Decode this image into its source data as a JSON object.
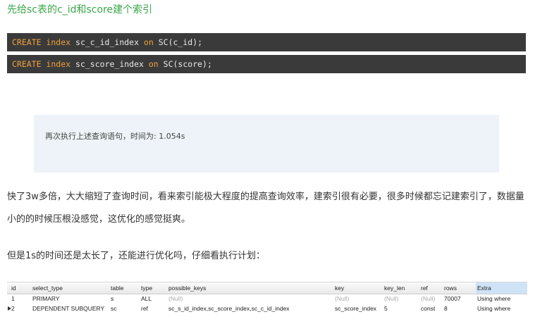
{
  "heading": "先给sc表的c_id和score建个索引",
  "code_lines": [
    {
      "kw1": "CREATE index",
      "name": " sc_c_id_index ",
      "kw2": "on",
      "rest": " SC(c_id);"
    },
    {
      "kw1": "CREATE index",
      "name": " sc_score_index ",
      "kw2": "on",
      "rest": " SC(score);"
    }
  ],
  "quote_text": "再次执行上述查询语句，时间为: 1.054s",
  "para1": "快了3w多倍，大大缩短了查询时间，看来索引能极大程度的提高查询效率，建索引很有必要，很多时候都忘记建索引了，数据量小的的时候压根没感觉，这优化的感觉挺爽。",
  "para2": "但是1s的时间还是太长了，还能进行优化吗，仔细看执行计划：",
  "result_table": {
    "columns": [
      "id",
      "select_type",
      "table",
      "type",
      "possible_keys",
      "key",
      "key_len",
      "ref",
      "rows",
      "Extra"
    ],
    "rows": [
      [
        "1",
        "PRIMARY",
        "s",
        "ALL",
        "(Null)",
        "(Null)",
        "(Null)",
        "(Null)",
        "70007",
        "Using where"
      ],
      [
        "2",
        "DEPENDENT SUBQUERY",
        "sc",
        "ref",
        "sc_s_id_index,sc_score_index,sc_c_id_index",
        "sc_score_index",
        "5",
        "const",
        "8",
        "Using where"
      ]
    ]
  },
  "colors": {
    "heading": "#3aa64a",
    "code_bg": "#3a3a3a",
    "code_keyword": "#f0a13c",
    "quote_bg": "#eef3f9",
    "null_text": "#a9a9a9",
    "selected_header": "#cfe3f7"
  }
}
